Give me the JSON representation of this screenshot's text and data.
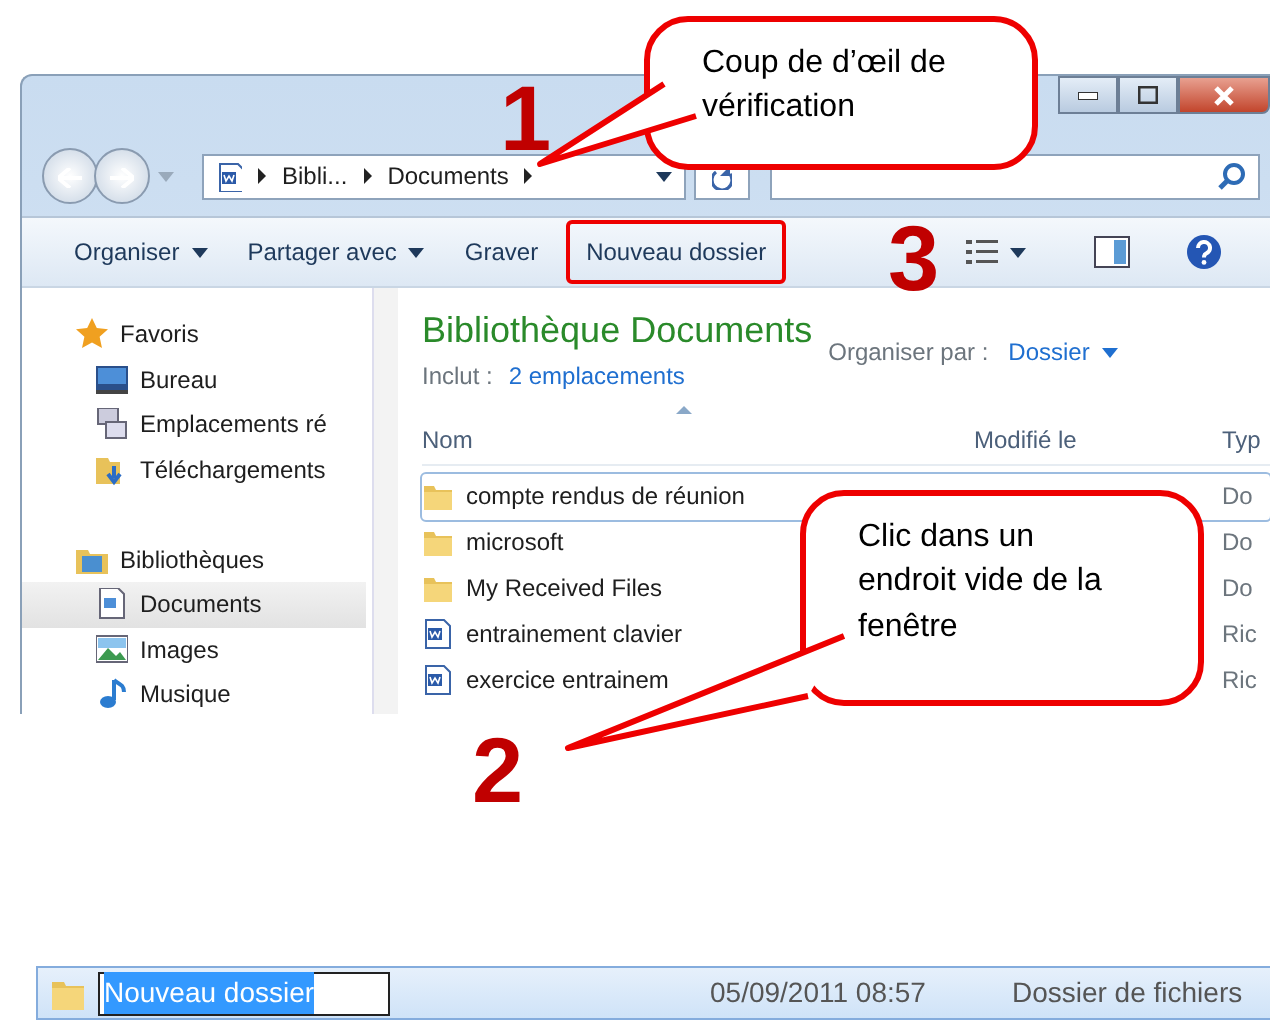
{
  "address_bar": {
    "segments": [
      "Bibli...",
      "Documents"
    ]
  },
  "toolbar": [
    {
      "label": "Organiser",
      "dropdown": true,
      "highlighted": false
    },
    {
      "label": "Partager avec",
      "dropdown": true,
      "highlighted": false
    },
    {
      "label": "Graver",
      "dropdown": false,
      "highlighted": false
    },
    {
      "label": "Nouveau dossier",
      "dropdown": false,
      "highlighted": true
    }
  ],
  "sidebar": [
    {
      "label": "Favoris",
      "children": [
        {
          "label": "Bureau",
          "selected": false
        },
        {
          "label": "Emplacements ré",
          "selected": false
        },
        {
          "label": "Téléchargements",
          "selected": false
        }
      ]
    },
    {
      "label": "Bibliothèques",
      "children": [
        {
          "label": "Documents",
          "selected": true
        },
        {
          "label": "Images",
          "selected": false
        },
        {
          "label": "Musique",
          "selected": false
        }
      ]
    }
  ],
  "library": {
    "title": "Bibliothèque Documents",
    "includes_label": "Inclut :",
    "includes_link": "2 emplacements",
    "arrange_label": "Organiser par :",
    "arrange_value": "Dossier"
  },
  "columns": [
    "Nom",
    "Modifié le",
    "Typ"
  ],
  "files": [
    {
      "kind": "folder",
      "name": "compte rendus de réunion",
      "type": "Do",
      "selected": true
    },
    {
      "kind": "folder",
      "name": "microsoft",
      "type": "Do",
      "selected": false
    },
    {
      "kind": "folder",
      "name": "My Received Files",
      "type": "Do",
      "selected": false
    },
    {
      "kind": "document",
      "name": "entrainement clavier",
      "type": "Ric",
      "selected": false
    },
    {
      "kind": "document",
      "name": "exercice entrainem",
      "type": "Ric",
      "selected": false
    }
  ],
  "new_folder_row": {
    "name": "Nouveau dossier",
    "modified": "05/09/2011 08:57",
    "type": "Dossier de fichiers"
  },
  "callouts": [
    "Coup de d’œil de vérification",
    "Clic dans un endroit vide de la fenêtre"
  ],
  "step_numbers": [
    "1",
    "2",
    "3"
  ]
}
